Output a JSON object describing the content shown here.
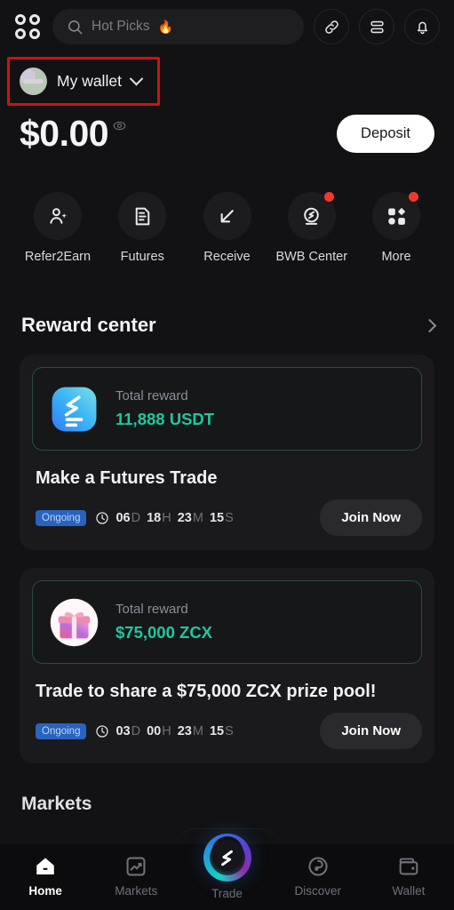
{
  "topbar": {
    "grid_icon": "grid-circles-icon",
    "search": {
      "icon": "search-icon",
      "placeholder": "Hot Picks",
      "flame": "🔥"
    },
    "actions": [
      {
        "icon": "link-icon",
        "name": "link-button"
      },
      {
        "icon": "list-rows-icon",
        "name": "list-button"
      },
      {
        "icon": "bell-icon",
        "name": "notifications-button"
      }
    ]
  },
  "wallet": {
    "name": "My wallet",
    "chevron": "chevron-down-icon",
    "avatar": "wallet-avatar",
    "highlight_color": "#cc1212"
  },
  "balance": {
    "amount": "$0.00",
    "visibility_icon": "eye-icon",
    "deposit_label": "Deposit"
  },
  "quick_actions": [
    {
      "label": "Refer2Earn",
      "icon": "user-add-icon",
      "badge": false
    },
    {
      "label": "Futures",
      "icon": "document-icon",
      "badge": false
    },
    {
      "label": "Receive",
      "icon": "arrow-down-left-icon",
      "badge": false
    },
    {
      "label": "BWB Center",
      "icon": "bwb-logo-icon",
      "badge": true
    },
    {
      "label": "More",
      "icon": "more-grid-icon",
      "badge": true
    }
  ],
  "reward_center": {
    "title": "Reward center",
    "chevron": "chevron-right-icon",
    "accent_color": "#1fc89f",
    "badge_color": "#2a63bd",
    "cards": [
      {
        "icon": "bitget-app-icon",
        "reward_label": "Total reward",
        "reward_amount": "11,888 USDT",
        "title": "Make a Futures Trade",
        "status": "Ongoing",
        "clock_icon": "clock-icon",
        "countdown": [
          {
            "value": "06",
            "unit": "D"
          },
          {
            "value": "18",
            "unit": "H"
          },
          {
            "value": "23",
            "unit": "M"
          },
          {
            "value": "15",
            "unit": "S"
          }
        ],
        "cta": "Join Now"
      },
      {
        "icon": "gift-icon",
        "reward_label": "Total reward",
        "reward_amount": "$75,000 ZCX",
        "title": "Trade to share a $75,000 ZCX prize pool!",
        "status": "Ongoing",
        "clock_icon": "clock-icon",
        "countdown": [
          {
            "value": "03",
            "unit": "D"
          },
          {
            "value": "00",
            "unit": "H"
          },
          {
            "value": "23",
            "unit": "M"
          },
          {
            "value": "15",
            "unit": "S"
          }
        ],
        "cta": "Join Now"
      }
    ]
  },
  "next_section": {
    "title": "Markets"
  },
  "bottom_nav": {
    "items": [
      {
        "label": "Home",
        "icon": "home-icon",
        "active": true
      },
      {
        "label": "Markets",
        "icon": "chart-icon",
        "active": false
      },
      {
        "label": "Trade",
        "icon": "bitget-logo-icon",
        "active": false,
        "center": true
      },
      {
        "label": "Discover",
        "icon": "compass-icon",
        "active": false
      },
      {
        "label": "Wallet",
        "icon": "wallet-icon",
        "active": false
      }
    ]
  }
}
